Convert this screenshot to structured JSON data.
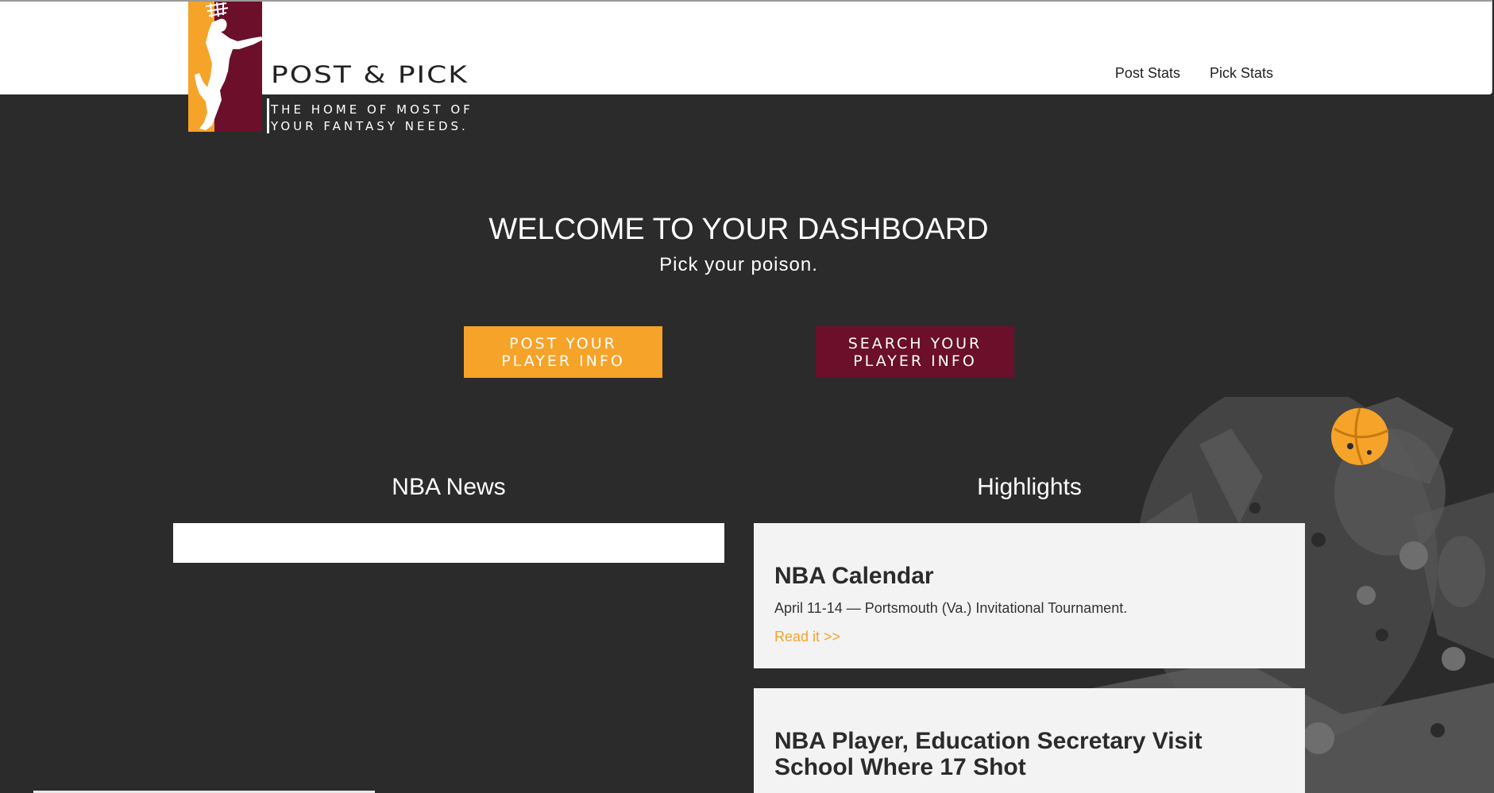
{
  "header": {
    "logo": {
      "title": "POST & PICK",
      "tagline": "THE HOME OF MOST OF YOUR FANTASY NEEDS."
    },
    "nav": [
      {
        "label": "Post Stats"
      },
      {
        "label": "Pick Stats"
      }
    ]
  },
  "hero": {
    "title": "WELCOME TO YOUR DASHBOARD",
    "subtitle": "Pick your poison.",
    "buttons": {
      "post": "POST YOUR PLAYER INFO",
      "search": "SEARCH YOUR PLAYER INFO"
    }
  },
  "sections": {
    "news": {
      "heading": "NBA News"
    },
    "highlights": {
      "heading": "Highlights",
      "cards": [
        {
          "title": "NBA Calendar",
          "text": "April 11-14 — Portsmouth (Va.) Invitational Tournament.",
          "link": "Read it >>"
        },
        {
          "title": "NBA Player, Education Secretary Visit School Where 17 Shot"
        }
      ]
    }
  },
  "colors": {
    "background": "#2b2b2b",
    "orange": "#f6a32a",
    "maroon": "#6b0f2b",
    "card": "#f3f3f3"
  },
  "icons": {
    "logo_art": "basketball-player-dunking-icon",
    "background_art": "basketball-player-silhouette-art"
  }
}
